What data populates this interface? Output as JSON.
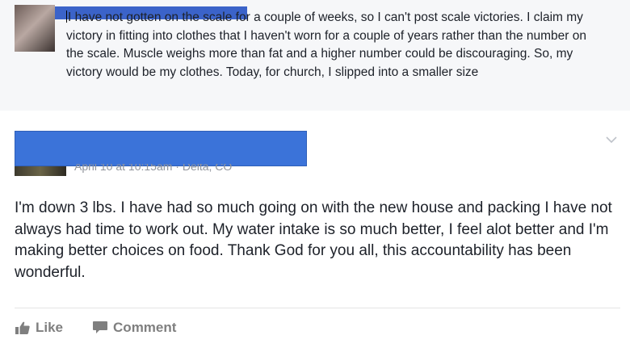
{
  "comment": {
    "text": "I have not gotten on the scale for a couple of weeks, so I can't post scale victories. I claim my victory in fitting into clothes that I haven't worn for a couple of years rather than the number on the scale. Muscle weighs more than fat and a higher number could be discouraging. So, my victory would be my clothes. Today, for church, I slipped into a smaller size"
  },
  "post": {
    "meta": "April 10 at 10:15am · Delta, CO",
    "body": "I'm down 3 lbs. I have had so much going on with the new house and packing I have not always had time to work out. My water intake is so much better, I feel alot better and I'm making better choices on food. Thank God for you all, this accountability has been wonderful."
  },
  "actions": {
    "like_label": "Like",
    "comment_label": "Comment"
  },
  "icons": {
    "like": "thumbs-up-icon",
    "comment": "speech-bubble-icon",
    "menu": "chevron-down-icon"
  },
  "colors": {
    "redaction": "#3b73d9",
    "action_gray": "#7f7f7f",
    "comment_bg": "#f6f7f9"
  }
}
